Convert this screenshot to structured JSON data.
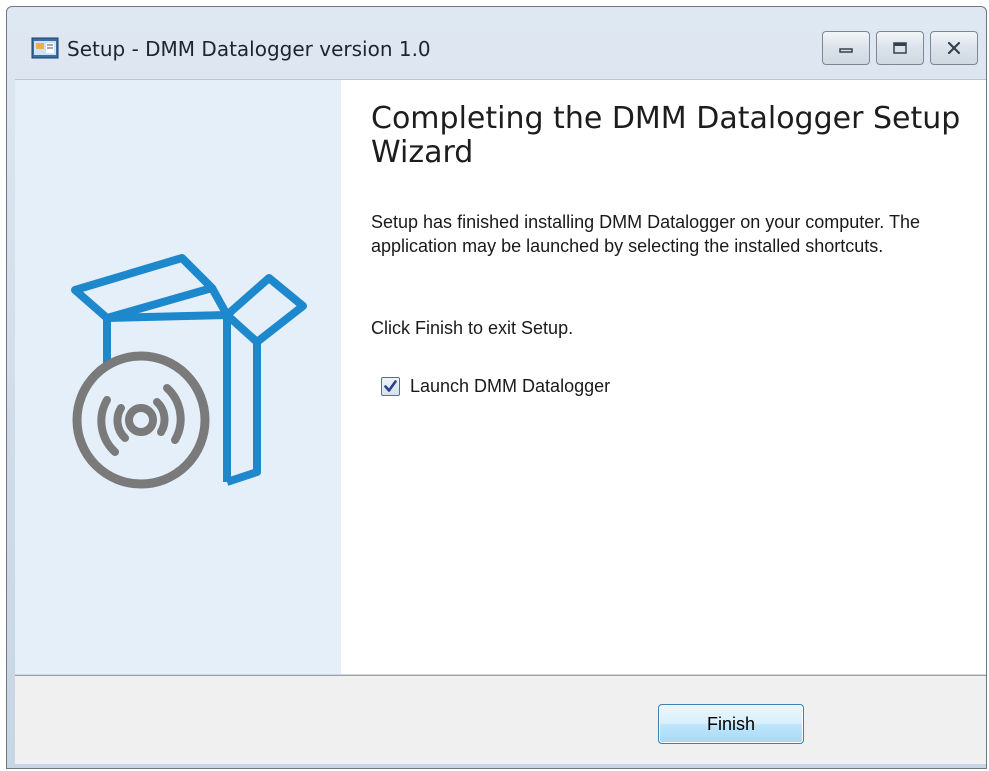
{
  "window": {
    "title": "Setup - DMM Datalogger version 1.0",
    "icons": {
      "app": "setup-installer-icon",
      "minimize": "minimize-icon",
      "maximize": "maximize-icon",
      "close": "close-icon"
    }
  },
  "sidebar": {
    "illustration": "box-with-disc-icon"
  },
  "main": {
    "heading": "Completing the DMM Datalogger Setup Wizard",
    "paragraph_1": "Setup has finished installing DMM Datalogger on your computer. The application may be launched by selecting the installed shortcuts.",
    "paragraph_2": "Click Finish to exit Setup.",
    "launch_checkbox": {
      "label": "Launch DMM Datalogger",
      "checked": true
    }
  },
  "footer": {
    "finish_label": "Finish"
  },
  "colors": {
    "sidebar_background": "#e4eff9",
    "illustration_blue": "#1e88cc",
    "illustration_gray": "#7a7a7a",
    "finish_button_border": "#3c7fb1"
  }
}
